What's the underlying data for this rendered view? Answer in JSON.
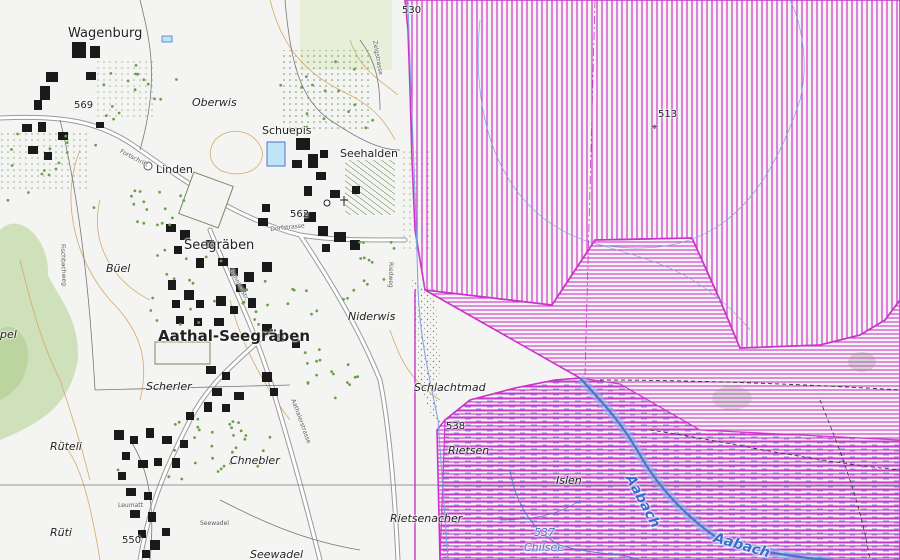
{
  "map": {
    "colors": {
      "background": "#f4f4f2",
      "forest": "#c8ddb0",
      "building": "#1a1a1a",
      "road_casing": "#9a9a9a",
      "contour": "#d4a96a",
      "water": "#4a76c8",
      "protected_zone": "#cc33cc"
    },
    "labels": {
      "wagenburg": "Wagenburg",
      "oberwis": "Oberwis",
      "schuepis": "Schuepis",
      "seehalden": "Seehalden",
      "linden": "Linden",
      "seegraben": "Seegräben",
      "buel": "Büel",
      "aathal_seegraben": "Aathal-Seegräben",
      "niderwis": "Niderwis",
      "scherler": "Scherler",
      "schlachtmad": "Schlachtmad",
      "rueteli": "Rüteli",
      "chnebler": "Chnebler",
      "rietsen": "Rietsen",
      "islen": "Islen",
      "rietsenacher": "Rietsenacher",
      "rueti": "Rüti",
      "seewadel": "Seewadel",
      "chilsee": "Chilsee",
      "aabach_upper": "Aabach",
      "aabach_lower": "Aabach",
      "pel": "pel"
    },
    "elevations": {
      "e569": "569",
      "e562": "562",
      "e513": "513",
      "e538": "538",
      "e550": "550",
      "e537": "537",
      "e530": "530"
    },
    "roads": {
      "r1": "Fortschritt",
      "r2": "Dorfstrasse",
      "r3": "Bahnhofstr.",
      "r4": "Fischbachweg",
      "r5": "Leumatt",
      "r6": "Seewadel",
      "r7": "Riedweg",
      "r8": "Zelgstrasse",
      "r9": "Aathalerstrasse"
    }
  }
}
